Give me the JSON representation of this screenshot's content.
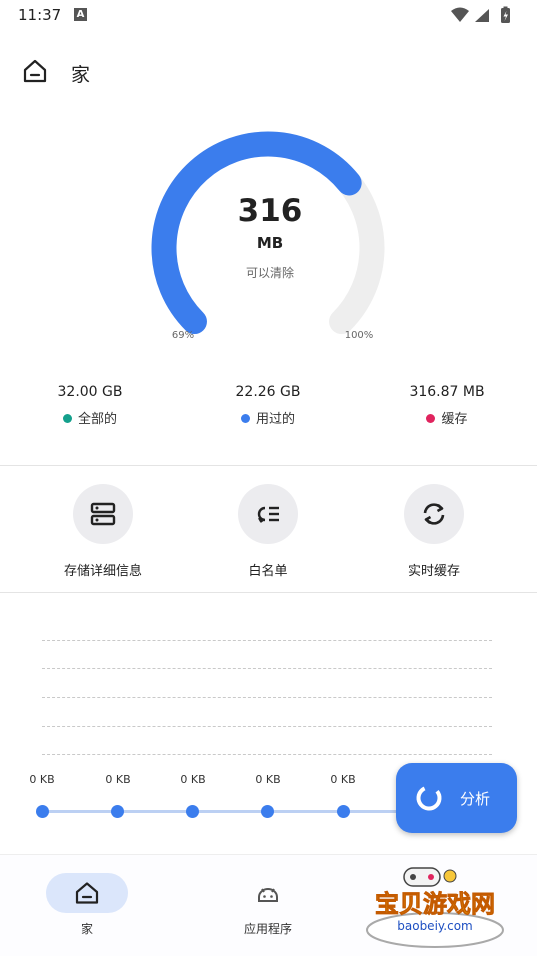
{
  "status_bar": {
    "time": "11:37",
    "notification_badge": "A"
  },
  "header": {
    "title": "家",
    "icon": "home-icon"
  },
  "gauge": {
    "value": "316",
    "unit": "MB",
    "caption": "可以清除",
    "start_label": "69%",
    "end_label": "100%",
    "fill_fraction": 0.69,
    "track_color": "#eeeeee",
    "fill_color": "#3b7ded"
  },
  "stats": [
    {
      "value": "32.00 GB",
      "label": "全部的",
      "color": "#14a08c"
    },
    {
      "value": "22.26 GB",
      "label": "用过的",
      "color": "#3b7ded"
    },
    {
      "value": "316.87 MB",
      "label": "缓存",
      "color": "#e0245e"
    }
  ],
  "actions": [
    {
      "label": "存储详细信息",
      "icon": "storage-icon"
    },
    {
      "label": "白名单",
      "icon": "whitelist-icon"
    },
    {
      "label": "实时缓存",
      "icon": "sync-icon"
    }
  ],
  "chart": {
    "points": [
      "0 KB",
      "0 KB",
      "0 KB",
      "0 KB",
      "0 KB"
    ]
  },
  "fab": {
    "label": "分析",
    "icon": "analyze-icon"
  },
  "bottom_nav": [
    {
      "label": "家",
      "icon": "home-icon",
      "active": true
    },
    {
      "label": "应用程序",
      "icon": "android-icon",
      "active": false
    }
  ],
  "watermark": {
    "title": "宝贝游戏网",
    "url": "baobeiy.com"
  }
}
